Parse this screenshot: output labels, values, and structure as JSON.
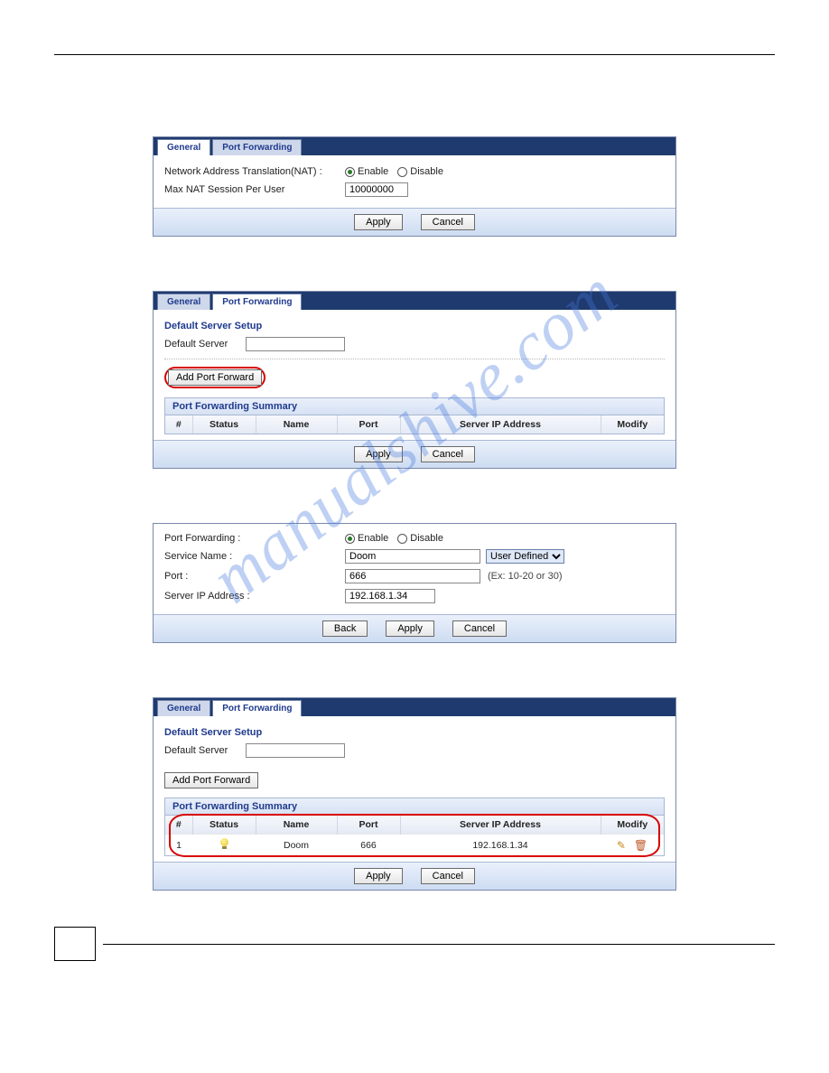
{
  "watermark": "manualshive.com",
  "panel1": {
    "tabs": {
      "general": "General",
      "portfwd": "Port Forwarding"
    },
    "nat_label": "Network Address Translation(NAT) :",
    "enable": "Enable",
    "disable": "Disable",
    "max_sess_label": "Max NAT Session Per User",
    "max_sess_value": "10000000",
    "apply": "Apply",
    "cancel": "Cancel"
  },
  "panel2": {
    "tabs": {
      "general": "General",
      "portfwd": "Port Forwarding"
    },
    "section": "Default Server Setup",
    "defserver_label": "Default Server",
    "defserver_value": "",
    "add_btn": "Add Port Forward",
    "summary_title": "Port Forwarding Summary",
    "cols": {
      "num": "#",
      "status": "Status",
      "name": "Name",
      "port": "Port",
      "ip": "Server IP Address",
      "modify": "Modify"
    },
    "apply": "Apply",
    "cancel": "Cancel"
  },
  "panel3": {
    "pf_label": "Port Forwarding :",
    "enable": "Enable",
    "disable": "Disable",
    "service_label": "Service Name :",
    "service_value": "Doom",
    "service_select": "User Defined",
    "port_label": "Port :",
    "port_value": "666",
    "port_hint": "(Ex: 10-20 or 30)",
    "ip_label": "Server IP Address :",
    "ip_value": "192.168.1.34",
    "back": "Back",
    "apply": "Apply",
    "cancel": "Cancel"
  },
  "panel4": {
    "tabs": {
      "general": "General",
      "portfwd": "Port Forwarding"
    },
    "section": "Default Server Setup",
    "defserver_label": "Default Server",
    "defserver_value": "",
    "add_btn": "Add Port Forward",
    "summary_title": "Port Forwarding Summary",
    "cols": {
      "num": "#",
      "status": "Status",
      "name": "Name",
      "port": "Port",
      "ip": "Server IP Address",
      "modify": "Modify"
    },
    "row": {
      "num": "1",
      "name": "Doom",
      "port": "666",
      "ip": "192.168.1.34"
    },
    "apply": "Apply",
    "cancel": "Cancel"
  }
}
